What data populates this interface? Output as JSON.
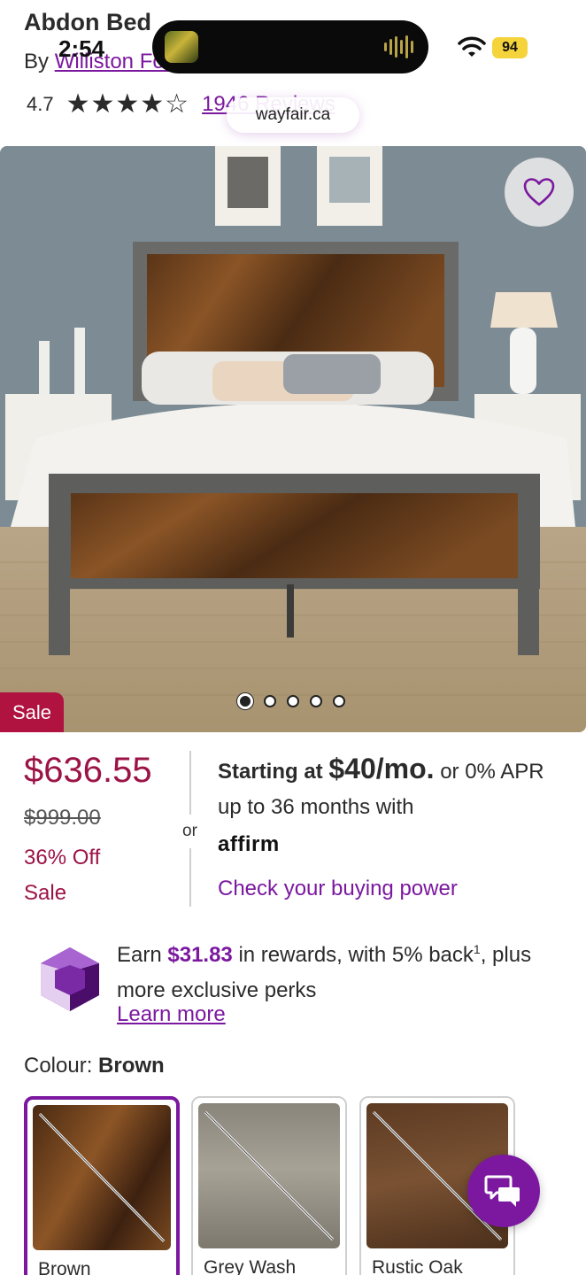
{
  "status": {
    "time": "2:54",
    "battery": "94"
  },
  "browser": {
    "url": "wayfair.ca"
  },
  "product": {
    "title": "Abdon Bed",
    "by_prefix": "By",
    "brand": "Williston Forge",
    "rating": "4.7",
    "reviews": "1946 Reviews"
  },
  "gallery": {
    "sale_badge": "Sale",
    "dot_count": 5,
    "active_dot": 0
  },
  "pricing": {
    "price": "$636.55",
    "original_price": "$999.00",
    "percent_off": "36% Off",
    "sale_label": "Sale",
    "or": "or"
  },
  "financing": {
    "starting_at": "Starting at",
    "monthly": "$40/mo.",
    "rest": "or 0% APR up to 36 months with",
    "provider": "affirm",
    "cta": "Check your buying power"
  },
  "rewards": {
    "earn": "Earn",
    "amount": "$31.83",
    "mid": "in rewards, with 5% back",
    "footnote": "1",
    "tail": ", plus more exclusive perks",
    "learn_more": "Learn more"
  },
  "colour": {
    "label": "Colour:",
    "selected": "Brown",
    "options": [
      {
        "name": "Brown"
      },
      {
        "name": "Grey Wash"
      },
      {
        "name": "Rustic Oak"
      }
    ]
  },
  "colors": {
    "brand_purple": "#7b189f",
    "sale_red": "#9c1346",
    "badge_red": "#b0133f"
  },
  "icons": {
    "favorite": "heart-outline-icon",
    "chat": "chat-bubbles-icon",
    "rewards": "purple-gem-icon"
  }
}
